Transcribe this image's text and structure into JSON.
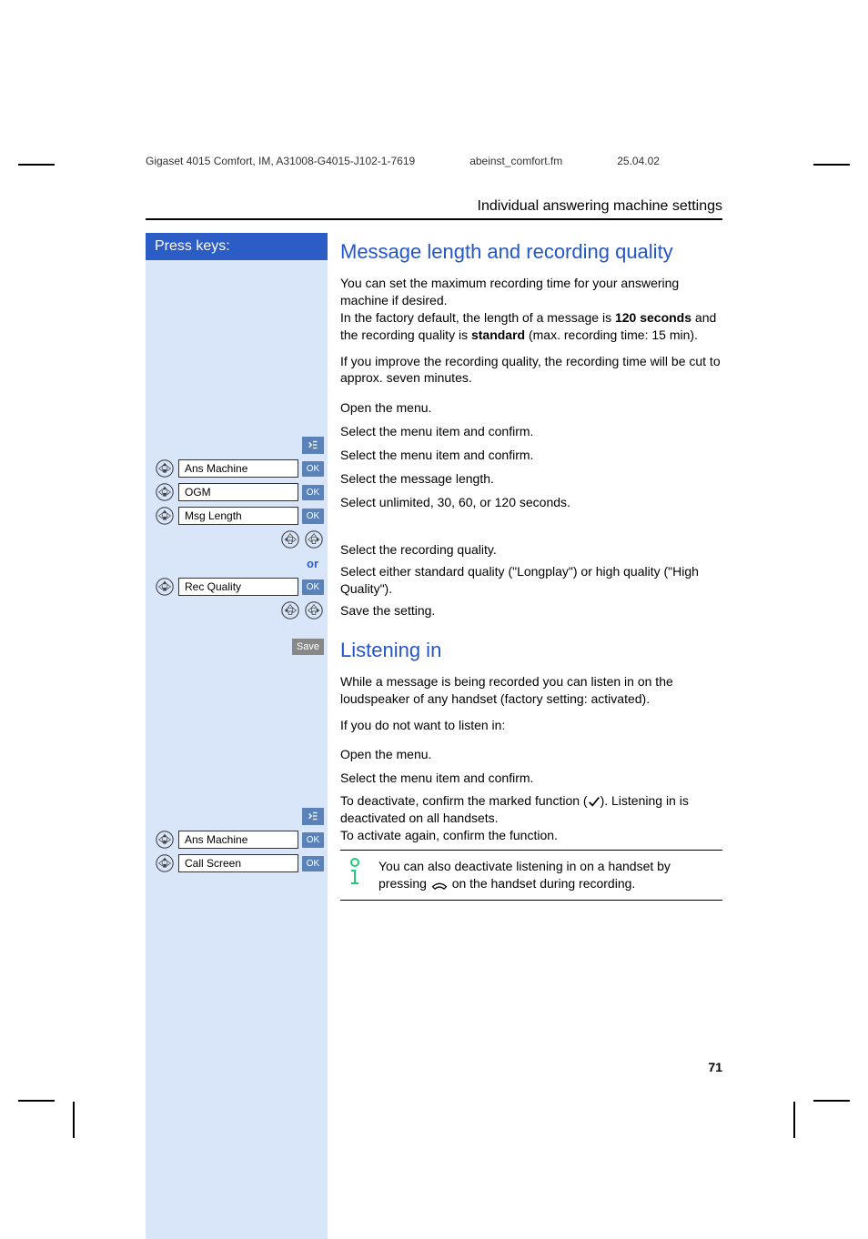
{
  "header": {
    "doc_id": "Gigaset 4015 Comfort, IM, A31008-G4015-J102-1-7619",
    "file": "abeinst_comfort.fm",
    "date": "25.04.02"
  },
  "section_title": "Individual answering machine settings",
  "press_keys_label": "Press keys:",
  "section1": {
    "heading": "Message length and recording quality",
    "para1a": "You can set the maximum recording time for your answering machine if desired.",
    "para1b": "In the factory default, the length of a message is ",
    "para1c_bold": "120 seconds",
    "para1d": " and the recording quality is ",
    "para1e_bold": "standard",
    "para1f": " (max. recording time: 15 min).",
    "para2": "If you improve the recording quality, the recording time will be cut to approx. seven minutes.",
    "steps": {
      "open_menu": "Open the menu.",
      "ans_machine_label": "Ans Machine",
      "ans_machine_desc": "Select the menu item and confirm.",
      "ogm_label": "OGM",
      "ogm_desc": "Select the menu item and confirm.",
      "msg_length_label": "Msg Length",
      "msg_length_desc": "Select the message length.",
      "select_seconds": "Select unlimited, 30, 60, or 120 seconds.",
      "or": "or",
      "rec_quality_label": "Rec Quality",
      "rec_quality_desc": "Select the recording quality.",
      "select_quality": "Select either standard quality (\"Longplay\") or high quality (\"High Quality\").",
      "save_label": "Save",
      "save_desc": "Save the setting."
    }
  },
  "section2": {
    "heading": "Listening in",
    "para1": "While a message is being recorded you can listen in on the loudspeaker of any handset (factory setting: activated).",
    "para2": "If you do not want to listen in:",
    "steps": {
      "open_menu": "Open the menu.",
      "ans_machine_label": "Ans Machine",
      "ans_machine_desc": "Select the menu item and confirm.",
      "call_screen_label": "Call Screen",
      "call_screen_desc_a": "To deactivate, confirm the marked function (",
      "call_screen_desc_b": "). Listening in is deactivated on all handsets.",
      "call_screen_desc_c": "To activate again, confirm the function."
    },
    "info_a": "You can also deactivate listening in on a handset by pressing ",
    "info_b": " on the handset during recording."
  },
  "ok_label": "OK",
  "page_number": "71"
}
